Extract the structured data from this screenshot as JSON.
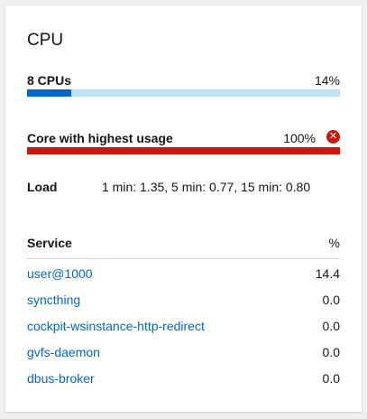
{
  "card": {
    "title": "CPU",
    "cpus": {
      "label": "8 CPUs",
      "value_text": "14%",
      "fraction": 0.14
    },
    "core": {
      "label": "Core with highest usage",
      "value_text": "100%",
      "fraction": 1.0,
      "status_icon": "error-circle-icon"
    },
    "load": {
      "label": "Load",
      "value": "1 min: 1.35, 5 min: 0.77, 15 min: 0.80"
    },
    "services": {
      "header_name": "Service",
      "header_value": "%",
      "rows": [
        {
          "name": "user@1000",
          "value": "14.4"
        },
        {
          "name": "syncthing",
          "value": "0.0"
        },
        {
          "name": "cockpit-wsinstance-http-redirect",
          "value": "0.0"
        },
        {
          "name": "gvfs-daemon",
          "value": "0.0"
        },
        {
          "name": "dbus-broker",
          "value": "0.0"
        }
      ]
    }
  },
  "colors": {
    "accent": "#0066cc",
    "accent_track": "#bee1f4",
    "danger": "#c9190b"
  }
}
